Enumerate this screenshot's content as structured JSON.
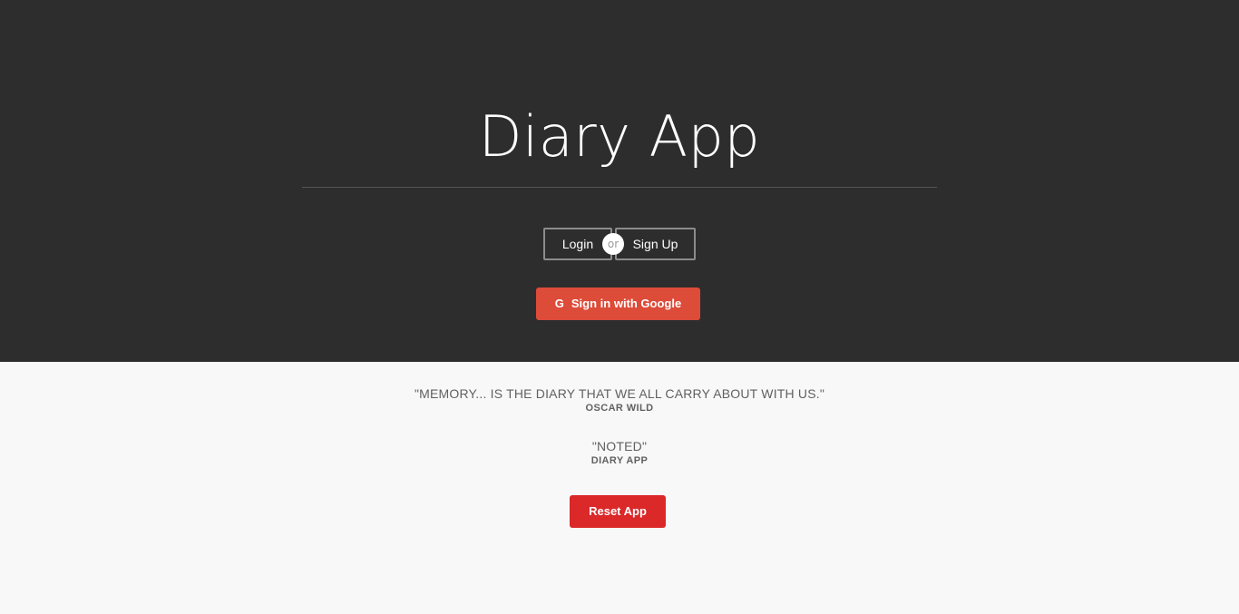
{
  "header": {
    "title": "Diary App"
  },
  "auth": {
    "login_label": "Login",
    "or_label": "or",
    "signup_label": "Sign Up",
    "google_label": "Sign in with Google",
    "google_icon": "google-g-icon"
  },
  "quotes": [
    {
      "text": "\"MEMORY... IS THE DIARY THAT WE ALL CARRY ABOUT WITH US.\"",
      "author": "OSCAR WILD"
    },
    {
      "text": "\"NOTED\"",
      "author": "DIARY APP"
    }
  ],
  "footer": {
    "reset_label": "Reset App"
  },
  "colors": {
    "hero_bg": "#2d2d2d",
    "page_bg": "#f8f8f8",
    "google_red": "#dd4b39",
    "reset_red": "#db2828"
  }
}
